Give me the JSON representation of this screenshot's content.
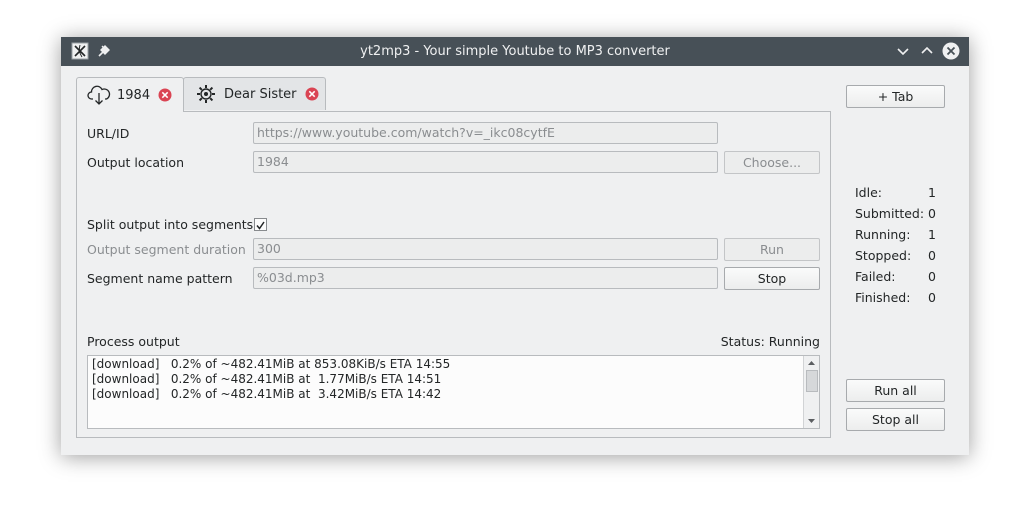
{
  "window": {
    "title": "yt2mp3 - Your simple Youtube to MP3 converter"
  },
  "titlebar": {
    "app_icon": "app-x-icon",
    "pin_icon": "pin-icon",
    "buttons": [
      "chevron-down-icon",
      "chevron-up-icon",
      "close-icon"
    ]
  },
  "tabs": [
    {
      "label": "1984",
      "icon": "cloud-download-icon",
      "active": true,
      "close_icon": "tab-close-icon"
    },
    {
      "label": "Dear Sister",
      "icon": "gear-icon",
      "active": false,
      "close_icon": "tab-close-icon"
    }
  ],
  "form": {
    "url_label": "URL/ID",
    "url_placeholder": "https://www.youtube.com/watch?v=_ikc08cytfE",
    "output_location_label": "Output location",
    "output_location_value": "1984",
    "choose_label": "Choose...",
    "split_label": "Split output into segments",
    "split_checked": true,
    "segment_duration_label": "Output segment duration",
    "segment_duration_value": "300",
    "run_label": "Run",
    "pattern_label": "Segment name pattern",
    "pattern_value": "%03d.mp3",
    "stop_label": "Stop"
  },
  "process": {
    "label": "Process output",
    "status": "Status: Running",
    "lines": [
      "[download]   0.2% of ~482.41MiB at 853.08KiB/s ETA 14:55",
      "[download]   0.2% of ~482.41MiB at  1.77MiB/s ETA 14:51",
      "[download]   0.2% of ~482.41MiB at  3.42MiB/s ETA 14:42"
    ]
  },
  "sidebar": {
    "add_tab_label": "+ Tab",
    "stats": [
      {
        "label": "Idle:",
        "value": "1"
      },
      {
        "label": "Submitted:",
        "value": "0"
      },
      {
        "label": "Running:",
        "value": "1"
      },
      {
        "label": "Stopped:",
        "value": "0"
      },
      {
        "label": "Failed:",
        "value": "0"
      },
      {
        "label": "Finished:",
        "value": "0"
      }
    ],
    "run_all_label": "Run all",
    "stop_all_label": "Stop all"
  },
  "colors": {
    "titlebar": "#475057",
    "window_bg": "#eff0f1",
    "tab_close": "#da4453",
    "text": "#232627",
    "disabled_text": "#8a8d90"
  }
}
